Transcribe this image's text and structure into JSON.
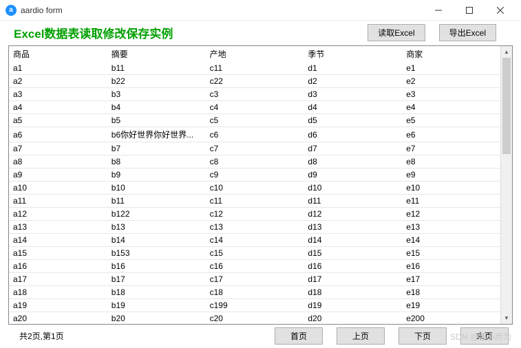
{
  "window": {
    "title": "aardio form"
  },
  "heading": "Excel数据表读取修改保存实例",
  "topbuttons": {
    "read": "读取Excel",
    "export": "导出Excel"
  },
  "columns": [
    "商品",
    "摘要",
    "产地",
    "季节",
    "商家"
  ],
  "rows": [
    [
      "a1",
      "b11",
      "c11",
      "d1",
      "e1"
    ],
    [
      "a2",
      "b22",
      "c22",
      "d2",
      "e2"
    ],
    [
      "a3",
      "b3",
      "c3",
      "d3",
      "e3"
    ],
    [
      "a4",
      "b4",
      "c4",
      "d4",
      "e4"
    ],
    [
      "a5",
      "b5",
      "c5",
      "d5",
      "e5"
    ],
    [
      "a6",
      "b6你好世界你好世界...",
      "c6",
      "d6",
      "e6"
    ],
    [
      "a7",
      "b7",
      "c7",
      "d7",
      "e7"
    ],
    [
      "a8",
      "b8",
      "c8",
      "d8",
      "e8"
    ],
    [
      "a9",
      "b9",
      "c9",
      "d9",
      "e9"
    ],
    [
      "a10",
      "b10",
      "c10",
      "d10",
      "e10"
    ],
    [
      "a11",
      "b11",
      "c11",
      "d11",
      "e11"
    ],
    [
      "a12",
      "b122",
      "c12",
      "d12",
      "e12"
    ],
    [
      "a13",
      "b13",
      "c13",
      "d13",
      "e13"
    ],
    [
      "a14",
      "b14",
      "c14",
      "d14",
      "e14"
    ],
    [
      "a15",
      "b153",
      "c15",
      "d15",
      "e15"
    ],
    [
      "a16",
      "b16",
      "c16",
      "d16",
      "e16"
    ],
    [
      "a17",
      "b17",
      "c17",
      "d17",
      "e17"
    ],
    [
      "a18",
      "b18",
      "c18",
      "d18",
      "e18"
    ],
    [
      "a19",
      "b19",
      "c199",
      "d19",
      "e19"
    ],
    [
      "a20",
      "b20",
      "c20",
      "d20",
      "e200"
    ]
  ],
  "footer": {
    "pageinfo": "共2页,第1页",
    "first": "首页",
    "prev": "上页",
    "next": "下页",
    "last": "末页"
  },
  "watermark": "SDN @善小而为"
}
